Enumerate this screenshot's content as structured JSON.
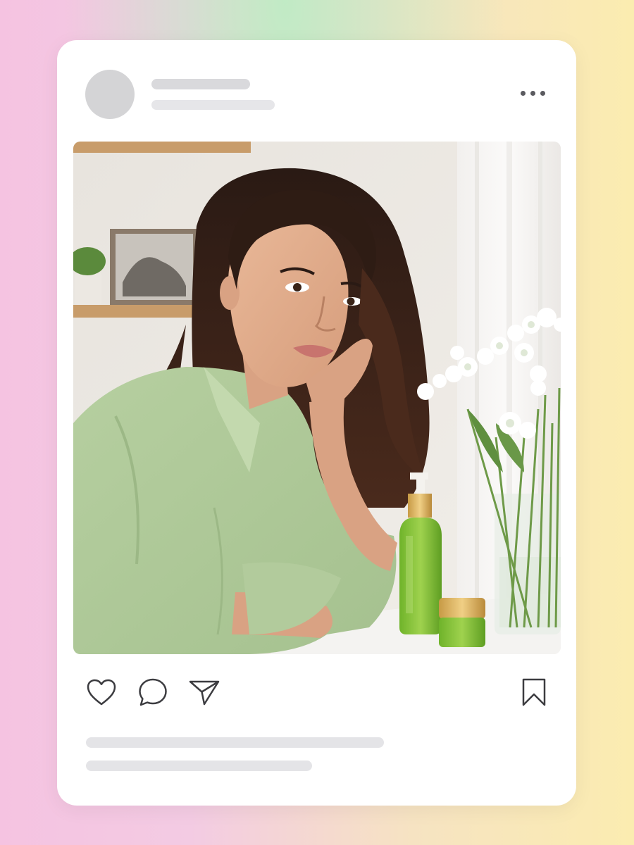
{
  "post": {
    "header": {
      "avatar": "avatar-placeholder",
      "username_placeholder": "skeleton-line",
      "subtitle_placeholder": "skeleton-line",
      "menu_icon": "more-horizontal-icon"
    },
    "image": {
      "subject": "woman-with-skincare-products-photo"
    },
    "actions": {
      "like_icon": "heart-icon",
      "comment_icon": "comment-icon",
      "share_icon": "send-icon",
      "save_icon": "bookmark-icon"
    },
    "caption": {
      "lines": [
        "skeleton-line",
        "skeleton-line"
      ]
    }
  },
  "colors": {
    "background_gradient": [
      "#f5c3e1",
      "#c6ecc4",
      "#fbecb0"
    ],
    "card": "#ffffff",
    "placeholder": "#dcdcdf",
    "icon_stroke": "#3c3c40"
  }
}
